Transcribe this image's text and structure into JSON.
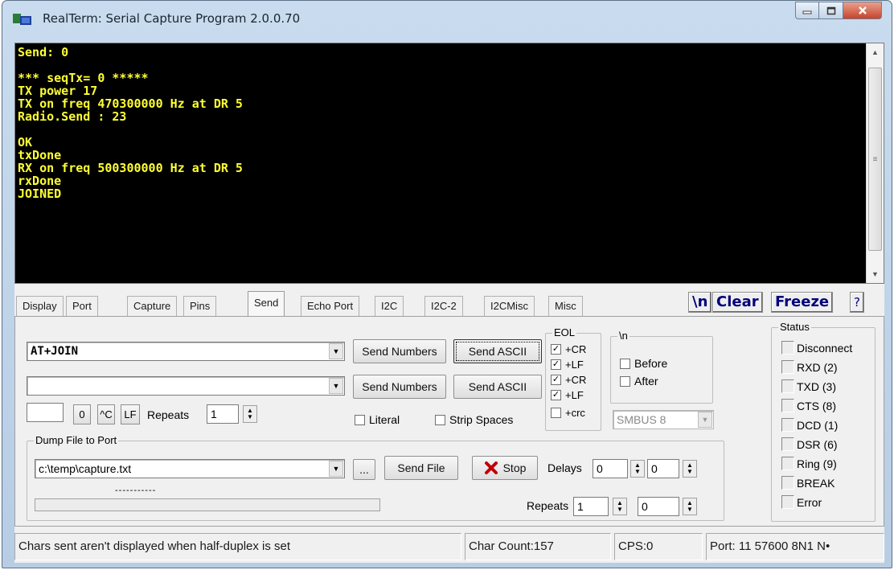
{
  "window": {
    "title": "RealTerm: Serial Capture Program 2.0.0.70"
  },
  "terminal": {
    "lines": "Send: 0\n\n*** seqTx= 0 *****\nTX power 17\nTX on freq 470300000 Hz at DR 5\nRadio.Send : 23\n\nOK\ntxDone\nRX on freq 500300000 Hz at DR 5\nrxDone\nJOINED"
  },
  "tabs": [
    "Display",
    "Port",
    "Capture",
    "Pins",
    "Send",
    "Echo Port",
    "I2C",
    "I2C-2",
    "I2CMisc",
    "Misc"
  ],
  "toolbar": {
    "newline": "\\n",
    "clear": "Clear",
    "freeze": "Freeze",
    "help": "?"
  },
  "send": {
    "line1_value": "AT+JOIN",
    "line2_value": "",
    "send_numbers_1": "Send Numbers",
    "send_ascii_1": "Send ASCII",
    "send_numbers_2": "Send Numbers",
    "send_ascii_2": "Send ASCII",
    "zero": "0",
    "ctrl_c": "^C",
    "lf": "LF",
    "repeats_label": "Repeats",
    "repeats_value": "1",
    "literal": "Literal",
    "strip_spaces": "Strip Spaces"
  },
  "eol": {
    "title": "EOL",
    "items": [
      {
        "label": "+CR",
        "checked": true
      },
      {
        "label": "+LF",
        "checked": true
      },
      {
        "label": "+CR",
        "checked": true
      },
      {
        "label": "+LF",
        "checked": true
      },
      {
        "label": "+crc",
        "checked": false
      }
    ]
  },
  "nl_group": {
    "title": "\\n",
    "before": "Before",
    "after": "After"
  },
  "smbus": "SMBUS 8",
  "dump": {
    "title": "Dump File to Port",
    "file_path": "c:\\temp\\capture.txt",
    "browse": "...",
    "send_file": "Send File",
    "stop": "Stop",
    "delays_label": "Delays",
    "delay1": "0",
    "delay2": "0",
    "repeats_label": "Repeats",
    "repeats1": "1",
    "repeats2": "0",
    "progress_label": "-----------"
  },
  "status_panel": {
    "title": "Status",
    "items": [
      "Disconnect",
      "RXD (2)",
      "TXD (3)",
      "CTS (8)",
      "DCD (1)",
      "DSR (6)",
      "Ring (9)",
      "BREAK",
      "Error"
    ]
  },
  "statusbar": {
    "message": "Chars sent aren't displayed when half-duplex is set",
    "char_count": "Char Count:157",
    "cps": "CPS:0",
    "port": "Port: 11 57600 8N1 N•"
  },
  "colors": {
    "terminal_bg": "#000000",
    "terminal_text": "#ffff33",
    "stop_icon": "#c00000"
  }
}
